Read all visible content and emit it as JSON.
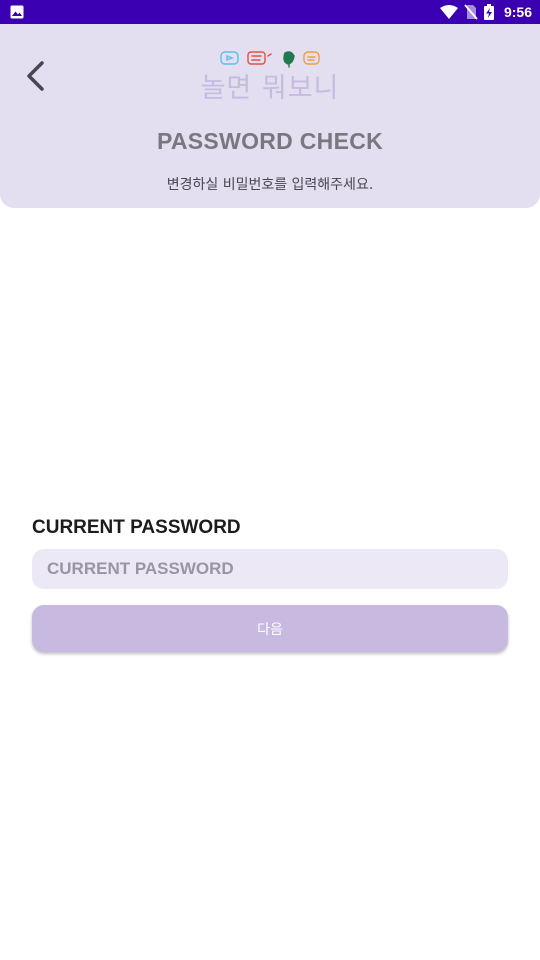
{
  "status_bar": {
    "time": "9:56",
    "icons": [
      "image-icon",
      "wifi-icon",
      "no-sim-icon",
      "battery-charging-icon"
    ]
  },
  "header": {
    "logo_text": "놀면 뭐보니",
    "title": "PASSWORD CHECK",
    "subtitle": "변경하실 비밀번호를 입력해주세요."
  },
  "form": {
    "label": "CURRENT PASSWORD",
    "password_placeholder": "CURRENT PASSWORD",
    "password_value": "",
    "next_label": "다음"
  },
  "colors": {
    "status_bar": "#3c00b3",
    "header_bg": "#e3def0",
    "input_bg": "#ece8f5",
    "button_bg": "#c7b9e0",
    "logo_blue": "#5bc0eb",
    "logo_red": "#e8503a",
    "logo_green": "#1f7a4d",
    "logo_orange": "#f0a030"
  }
}
